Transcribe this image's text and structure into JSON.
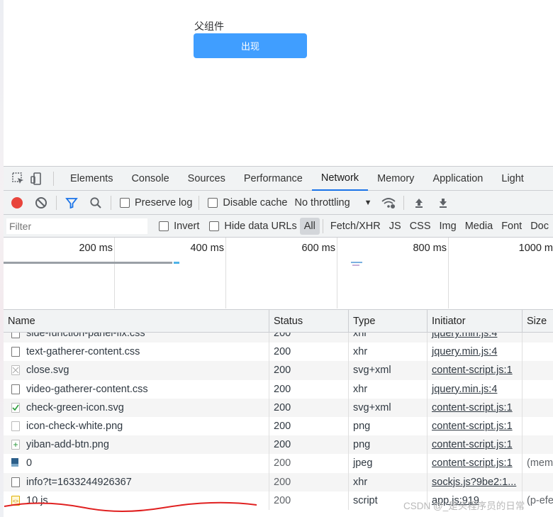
{
  "page": {
    "parent_title": "父组件",
    "show_button": "出现"
  },
  "devtools": {
    "tabs": [
      "Elements",
      "Console",
      "Sources",
      "Performance",
      "Network",
      "Memory",
      "Application",
      "Light"
    ],
    "active_tab": "Network",
    "toolbar": {
      "preserve_log": "Preserve log",
      "disable_cache": "Disable cache",
      "throttling": "No throttling"
    },
    "filter": {
      "placeholder": "Filter",
      "invert": "Invert",
      "hide_data_urls": "Hide data URLs",
      "types": [
        "All",
        "Fetch/XHR",
        "JS",
        "CSS",
        "Img",
        "Media",
        "Font",
        "Doc"
      ],
      "active_type": "All"
    },
    "timeline": {
      "ticks": [
        "200 ms",
        "400 ms",
        "600 ms",
        "800 ms",
        "1000 m"
      ]
    },
    "table": {
      "headers": {
        "name": "Name",
        "status": "Status",
        "type": "Type",
        "initiator": "Initiator",
        "size": "Size"
      },
      "rows": [
        {
          "name": "side-function-panel-fix.css",
          "status": "200",
          "type": "xhr",
          "initiator": "jquery.min.js:4",
          "size": "",
          "icon": "doc-icon"
        },
        {
          "name": "text-gatherer-content.css",
          "status": "200",
          "type": "xhr",
          "initiator": "jquery.min.js:4",
          "size": "",
          "icon": "doc-icon"
        },
        {
          "name": "close.svg",
          "status": "200",
          "type": "svg+xml",
          "initiator": "content-script.js:1",
          "size": "",
          "icon": "close-icon"
        },
        {
          "name": "video-gatherer-content.css",
          "status": "200",
          "type": "xhr",
          "initiator": "jquery.min.js:4",
          "size": "",
          "icon": "doc-icon"
        },
        {
          "name": "check-green-icon.svg",
          "status": "200",
          "type": "svg+xml",
          "initiator": "content-script.js:1",
          "size": "",
          "icon": "check-icon"
        },
        {
          "name": "icon-check-white.png",
          "status": "200",
          "type": "png",
          "initiator": "content-script.js:1",
          "size": "",
          "icon": "image-icon"
        },
        {
          "name": "yiban-add-btn.png",
          "status": "200",
          "type": "png",
          "initiator": "content-script.js:1",
          "size": "",
          "icon": "plus-image-icon"
        },
        {
          "name": "0",
          "status": "200",
          "type": "jpeg",
          "initiator": "content-script.js:1",
          "size": "(mem",
          "icon": "photo-icon"
        },
        {
          "name": "info?t=1633244926367",
          "status": "200",
          "type": "xhr",
          "initiator": "sockjs.js?9be2:1...",
          "size": "",
          "icon": "doc-icon"
        },
        {
          "name": "10.js",
          "status": "200",
          "type": "script",
          "initiator": "app.js:919",
          "size": "(p-efe",
          "icon": "script-icon"
        }
      ]
    }
  },
  "watermark": "CSDN @_是头程序员的日常",
  "colors": {
    "button": "#409eff",
    "tab_underline": "#1a73e8",
    "record": "#e8453c",
    "filter_icon": "#1a73e8",
    "scribble": "#e02020"
  }
}
